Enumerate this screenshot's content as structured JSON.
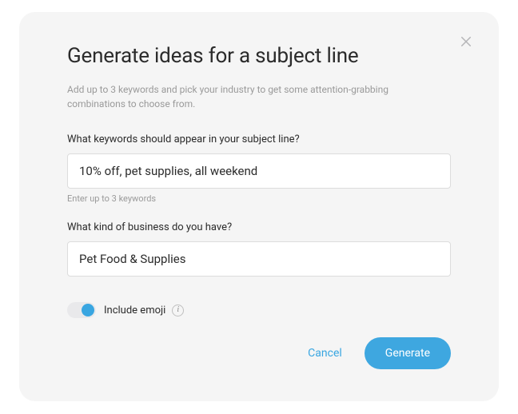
{
  "modal": {
    "title": "Generate ideas for a subject line",
    "subtitle": "Add up to 3 keywords and pick your industry to get some attention-grabbing combinations to choose from.",
    "keywords": {
      "label": "What keywords should appear in your subject line?",
      "value": "10% off, pet supplies, all weekend",
      "helper": "Enter up to 3 keywords"
    },
    "business": {
      "label": "What kind of business do you have?",
      "value": "Pet Food & Supplies"
    },
    "emoji_toggle": {
      "label": "Include emoji",
      "enabled": true
    },
    "actions": {
      "cancel": "Cancel",
      "generate": "Generate"
    }
  }
}
